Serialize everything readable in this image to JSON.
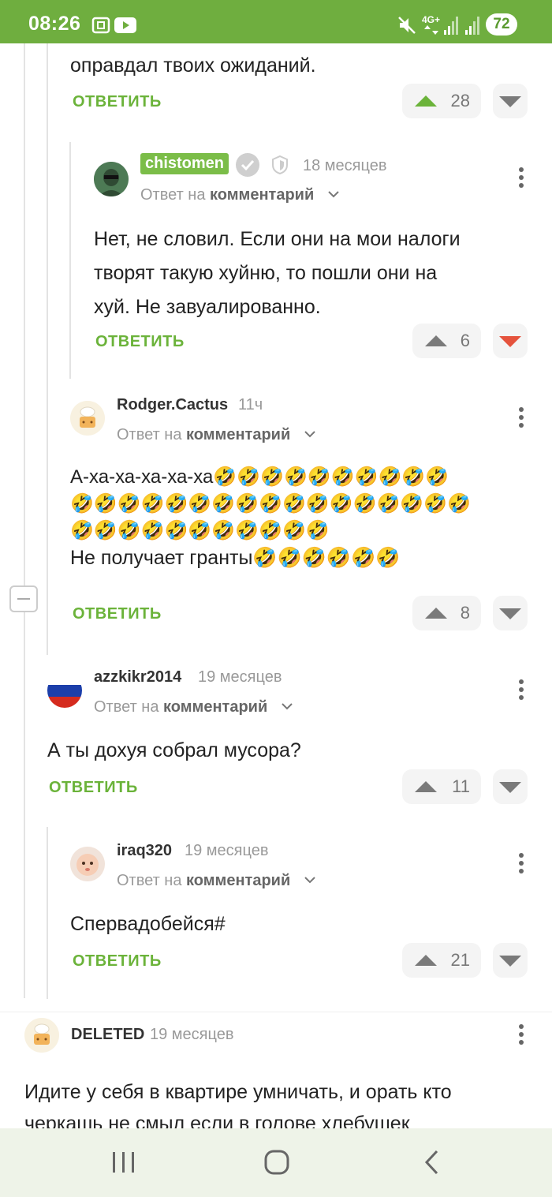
{
  "status_bar": {
    "time": "08:26",
    "network": "4G+",
    "battery": "72",
    "icons": [
      "screenshot-icon",
      "youtube-icon",
      "mute-icon",
      "signal-icon",
      "signal-icon"
    ]
  },
  "comments": [
    {
      "id": "top-partial",
      "text": "оправдал твоих ожиданий.",
      "reply_label": "ОТВЕТИТЬ",
      "votes": "28"
    },
    {
      "id": "chistomen",
      "author": "chistomen",
      "time": "18 месяцев",
      "reply_prefix": "Ответ на",
      "reply_target": "комментарий",
      "text_lines": [
        "Нет, не словил. Если они на мои налоги",
        "творят такую хуйню, то пошли они на",
        "хуй. Не завуалированно."
      ],
      "reply_label": "ОТВЕТИТЬ",
      "votes": "6"
    },
    {
      "id": "rodger",
      "author": "Rodger.Cactus",
      "time": "11ч",
      "reply_prefix": "Ответ на",
      "reply_target": "комментарий",
      "text_lines": [
        "А-ха-ха-ха-ха-ха🤣🤣🤣🤣🤣🤣🤣🤣🤣🤣",
        "🤣🤣🤣🤣🤣🤣🤣🤣🤣🤣🤣🤣🤣🤣🤣🤣🤣",
        "🤣🤣🤣🤣🤣🤣🤣🤣🤣🤣🤣",
        "Не получает гранты🤣🤣🤣🤣🤣🤣"
      ],
      "reply_label": "ОТВЕТИТЬ",
      "votes": "8"
    },
    {
      "id": "azzkikr",
      "author": "azzkikr2014",
      "time": "19 месяцев",
      "reply_prefix": "Ответ на",
      "reply_target": "комментарий",
      "text_lines": [
        "А ты дохуя собрал мусора?"
      ],
      "reply_label": "ОТВЕТИТЬ",
      "votes": "11"
    },
    {
      "id": "iraq",
      "author": "iraq320",
      "time": "19 месяцев",
      "reply_prefix": "Ответ на",
      "reply_target": "комментарий",
      "text_lines": [
        "Спервадобейся#"
      ],
      "reply_label": "ОТВЕТИТЬ",
      "votes": "21"
    },
    {
      "id": "deleted",
      "author": "DELETED",
      "time": "19 месяцев",
      "text_lines": [
        "Идите у себя в квартире умничать, и орать кто",
        "черкашь не смыл если в голове хлебушек"
      ]
    }
  ],
  "nav": {
    "icons": [
      "recent-apps-icon",
      "home-icon",
      "back-icon"
    ]
  }
}
